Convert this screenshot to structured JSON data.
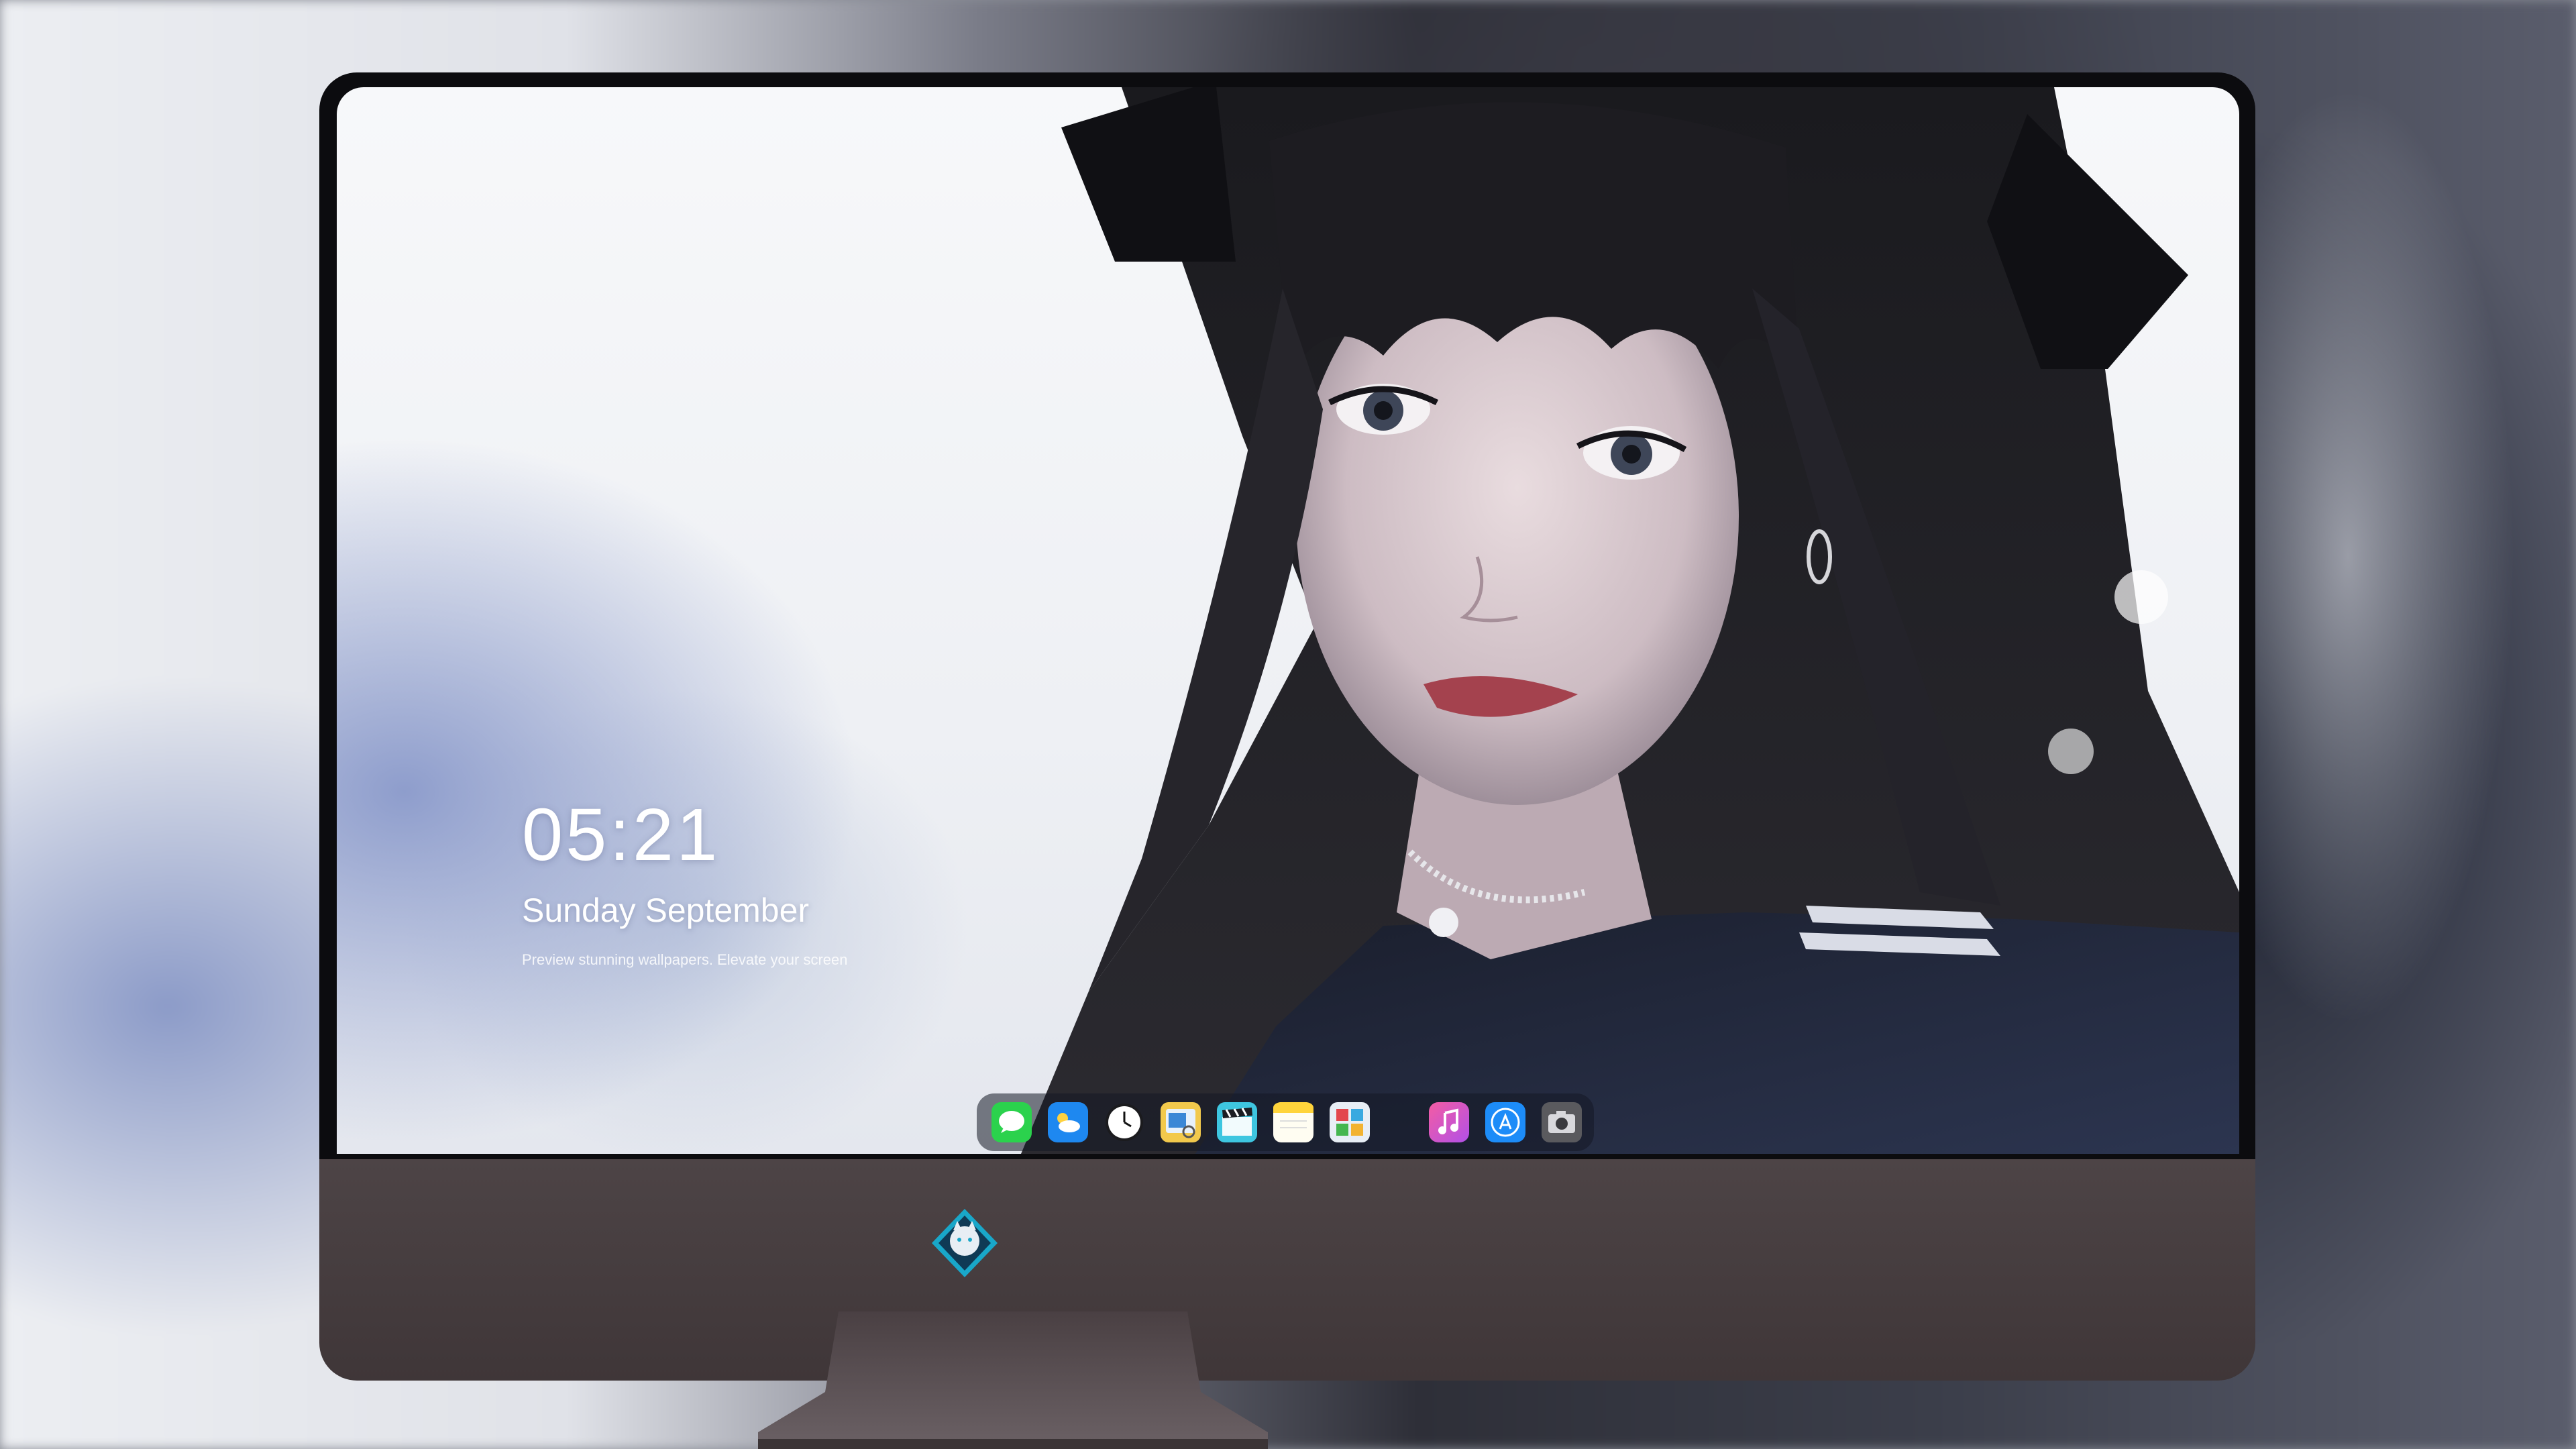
{
  "lockscreen": {
    "time": "05:21",
    "date": "Sunday September",
    "caption": "Preview stunning wallpapers. Elevate your screen"
  },
  "dock": {
    "apps": [
      {
        "name": "Messages",
        "icon": "messages-icon",
        "color": "#2bd24d"
      },
      {
        "name": "Weather",
        "icon": "weather-icon",
        "color": "#1e88f0"
      },
      {
        "name": "Clock",
        "icon": "clock-icon",
        "color": "#ffffff"
      },
      {
        "name": "Preview",
        "icon": "preview-icon",
        "color": "#f2c94c"
      },
      {
        "name": "Final Cut",
        "icon": "clapperboard-icon",
        "color": "#3ec6e0"
      },
      {
        "name": "Notes",
        "icon": "notes-icon",
        "color": "#ffd43b"
      },
      {
        "name": "Photo Booth",
        "icon": "photobooth-icon",
        "color": "#e8eef5"
      },
      {
        "name": "iTunes",
        "icon": "music-icon",
        "color": "#d94ee6"
      },
      {
        "name": "App Store",
        "icon": "appstore-icon",
        "color": "#1d8cf8"
      },
      {
        "name": "Screenshot",
        "icon": "camera-icon",
        "color": "#5a5a5e"
      }
    ]
  },
  "monitor": {
    "logo": "mascot-logo-icon"
  }
}
